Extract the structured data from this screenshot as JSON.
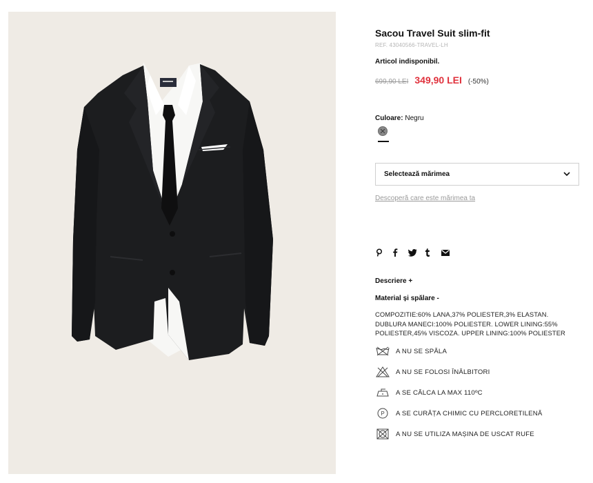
{
  "product": {
    "title": "Sacou Travel Suit slim-fit",
    "reference": "REF. 43040566-TRAVEL-LH",
    "availability": "Articol indisponibil.",
    "old_price": "699,90 LEI",
    "new_price": "349,90 LEI",
    "discount": "(-50%)",
    "color_label": "Culoare:",
    "color_value": "Negru",
    "size_select_label": "Selectează mărimea",
    "size_guide_link": "Descoperă care este mărimea ta",
    "image_alt": "Black slim-fit suit jacket with white shirt and black tie"
  },
  "social_icons": [
    "pinterest-icon",
    "facebook-icon",
    "twitter-icon",
    "tumblr-icon",
    "email-icon"
  ],
  "sections": {
    "description": "Descriere +",
    "material": "Material și spălare -",
    "composition_lines": [
      "COMPOZITIE:60% LANA,37% POLIESTER,3% ELASTAN.",
      "DUBLURA MANECI:100% POLIESTER. LOWER LINING:55%",
      "POLIESTER,45% VISCOZA. UPPER LINING:100% POLIESTER"
    ]
  },
  "care": [
    {
      "icon": "no-wash-icon",
      "text": "A NU SE SPĂLA"
    },
    {
      "icon": "no-bleach-icon",
      "text": "A NU SE FOLOSI ÎNĂLBITORI"
    },
    {
      "icon": "iron-icon",
      "text": "A SE CĂLCA LA MAX 110ºC"
    },
    {
      "icon": "dry-clean-p-icon",
      "text": "A SE CURĂȚA CHIMIC CU PERCLORETILENĂ"
    },
    {
      "icon": "no-tumble-dry-icon",
      "text": "A NU SE UTILIZA MAȘINA DE USCAT RUFE"
    }
  ],
  "colors": {
    "price_sale": "#e0313c",
    "background_photo": "#efebe5",
    "jacket": "#1c1d1f",
    "muted_text": "#9a9a9a"
  }
}
